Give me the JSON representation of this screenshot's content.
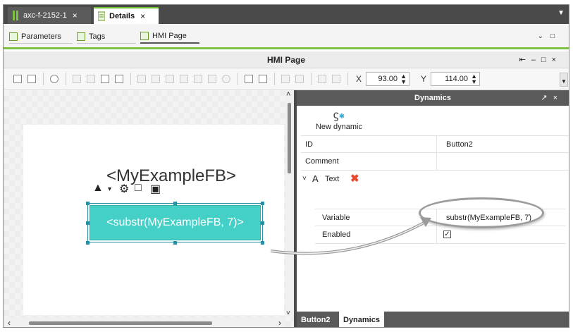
{
  "doc_tabs": [
    {
      "label": "axc-f-2152-1",
      "close": "×"
    },
    {
      "label": "Details",
      "close": "×"
    }
  ],
  "doc_menu_icon": "chevron-down-icon",
  "sub_tabs": [
    {
      "label": "Parameters"
    },
    {
      "label": "Tags"
    },
    {
      "label": "HMI Page"
    }
  ],
  "hmi_page": {
    "title": "HMI Page"
  },
  "toolbar": {
    "x_label": "X",
    "x_value": "93.00",
    "y_label": "Y",
    "y_value": "114.00"
  },
  "canvas": {
    "fb_label": "<MyExampleFB>",
    "button_text": "<substr(MyExampleFB, 7)>",
    "button_color": "#45d0c7"
  },
  "dynamics": {
    "title": "Dynamics",
    "new_dynamic_label": "New dynamic",
    "rows": [
      {
        "key": "ID",
        "value": "Button2"
      },
      {
        "key": "Comment",
        "value": ""
      }
    ],
    "group": {
      "label": "Text"
    },
    "inner_rows": [
      {
        "key": "Variable",
        "value": "substr(MyExampleFB, 7)"
      },
      {
        "key": "Enabled",
        "checked": true
      }
    ],
    "delete_color": "#e8492a"
  },
  "footer_tabs": [
    {
      "label": "Button2"
    },
    {
      "label": "Dynamics"
    }
  ],
  "accent_color": "#7dc242"
}
